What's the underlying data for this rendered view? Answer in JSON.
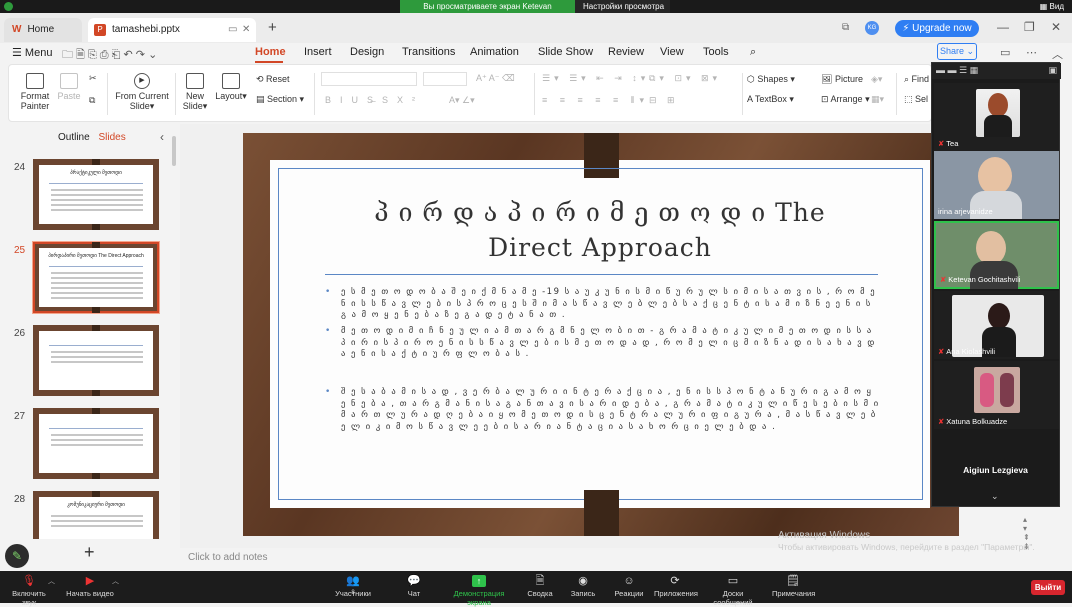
{
  "zoom_banner": {
    "sharing_text": "Вы просматриваете экран Ketevan Gochitashvili",
    "settings_label": "Настройки просмотра",
    "view_label": "Вид"
  },
  "titlebar": {
    "home_tab": "Home",
    "doc_tab": "tamashebi.pptx",
    "upgrade": "Upgrade now"
  },
  "menubar": {
    "menu": "Menu",
    "items": [
      "Home",
      "Insert",
      "Design",
      "Transitions",
      "Animation",
      "Slide Show",
      "Review",
      "View",
      "Tools"
    ],
    "share": "Share"
  },
  "ribbon": {
    "format_painter": [
      "Format",
      "Painter"
    ],
    "paste": "Paste",
    "from_current_slide": [
      "From Current",
      "Slide"
    ],
    "new_slide": [
      "New",
      "Slide"
    ],
    "layout": "Layout",
    "reset": "Reset",
    "section": "Section",
    "shapes": "Shapes",
    "picture": "Picture",
    "textbox": "TextBox",
    "arrange": "Arrange",
    "find": "Find",
    "select": "Sel"
  },
  "left_panel": {
    "tabs": [
      "Outline",
      "Slides"
    ],
    "slides": [
      {
        "num": "24",
        "title": "პრაქტიკული მეთოდი"
      },
      {
        "num": "25",
        "title": "პირდაპირი მეთოდი The Direct Approach"
      },
      {
        "num": "26",
        "title": ""
      },
      {
        "num": "27",
        "title": ""
      },
      {
        "num": "28",
        "title": "კომუნიკაციური მეთოდი"
      }
    ]
  },
  "slide": {
    "title_line1": "პ ი რ დ ა პ ი რ ი  მ ე თ ო დ ი  The",
    "title_line2": "Direct Approach",
    "bullets": [
      "ე ს  მ ე თ ო დ ო ბ ა  შ ე ი ქ მ ნ ა  მ ე -19 ს ა უ კ უ ნ ი ს  მ ი წ უ რ უ ლ ს  ი მ ი ს ა თ ვ ი ს , რ ო მ  ე ნ ი ს  ს წ ა ვ ლ ე ბ ი ს  პ რ ო ც ე ს შ ი  მ ა ს წ ა ვ ლ ე ბ ლ ე ბ ს  ა ქ ც ე ნ ტ ი  ს ა მ ი ზ ნ ე  ე ნ ი ს  გ ა მ ო ყ ე ნ ე ბ ა ზ ე  გ ა დ ე ტ ა ნ ა თ .",
      "მ ე თ ო დ ი  მ ი ჩ ნ ე უ ლ ი ა  მ თ ა რ გ მ ნ ე ლ ო ბ ი თ - გ რ ა მ ა ტ ი კ უ ლ ი  მ ე თ ო დ ი ს  ს ა პ ი რ ი ს პ ი რ ო  ე ნ ი ს  ს წ ა ვ ლ ე ბ ი ს  მ ე თ ო დ ა დ , რ ო მ ე ლ ი ც  მ ი ზ ნ ა დ  ი ს ა ხ ა ვ დ ა  ე ნ ი ს  ა ქ ტ ი უ რ  ფ ლ ო ბ ა ს .",
      "შ ე ს ა ბ ა მ ი ს ა დ , ვ ე რ ბ ა ლ უ რ ი  ი ნ ტ ე რ ა ქ ც ი ა , ე ნ ი ს  ს პ ო ნ ტ ა ნ უ რ ი  გ ა მ ო ყ ე ნ ე ბ ა , თ ა რ გ მ ა ნ ი ს ა გ ა ნ  თ ა ვ ი ს ა რ ი დ ე ბ ა ,  გ რ ა მ ა ტ ი კ უ ლ ი  წ ე ს ე ბ ი ს  მ ი მ ა რ თ  ლ უ რ ა დ ღ ე ბ ა  ი ყ ო  მ ე თ ო დ ი ს  ც ე ნ ტ რ ა ლ უ რ ი  ფ ი გ უ რ ა ,  მ ა ს წ ა ვ ლ ე ბ ე ლ ი  კ ი  მ ო ს წ ა ვ ლ ე ე ბ ი ს  ა რ ი ა ნ ტ ა ც ი ა ს  ა ხ ო რ ც ი ე ლ ე ბ დ ა ."
    ],
    "notes_placeholder": "Click to add notes"
  },
  "watermark": {
    "line1": "Активация Windows",
    "line2": "Чтобы активировать Windows, перейдите в раздел \"Параметры\"."
  },
  "participants": [
    {
      "name": "Tea",
      "muted": true
    },
    {
      "name": "irina arjevanidze",
      "muted": false
    },
    {
      "name": "Ketevan Gochitashvili",
      "muted": true,
      "active": true
    },
    {
      "name": "Ana Kiolashvili",
      "muted": true
    },
    {
      "name": "Xatuna Bolkuadze",
      "muted": true
    },
    {
      "name": "Aigiun Lezgieva",
      "muted": false
    }
  ],
  "bottombar": {
    "mute": "Включить звук",
    "video": "Начать видео",
    "participants": "Участники",
    "participants_count": "8",
    "chat": "Чат",
    "share": "Демонстрация экрана",
    "summary": "Сводка",
    "record": "Запись",
    "reactions": "Реакции",
    "apps": "Приложения",
    "whiteboard": "Доски сообщений",
    "notes": "Примечания",
    "leave": "Выйти"
  }
}
